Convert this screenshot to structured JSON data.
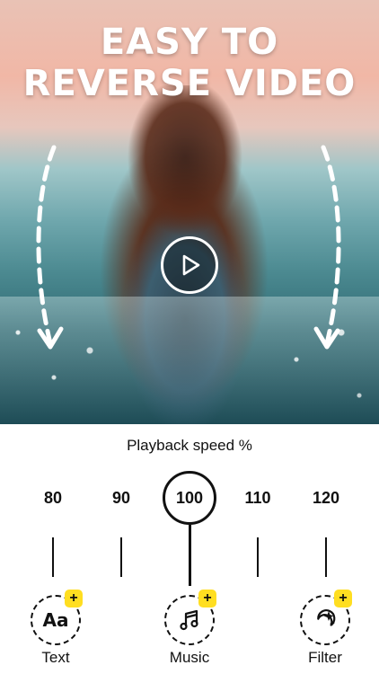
{
  "hero": {
    "headline_line1": "EASY TO",
    "headline_line2": "REVERSE VIDEO"
  },
  "icons": {
    "play": "play-icon",
    "arrow_down_left": "dashed-arrow-down-icon",
    "arrow_down_right": "dashed-arrow-down-icon",
    "text_tool": "text-aa-icon",
    "music_tool": "music-note-icon",
    "filter_tool": "sparkle-moon-icon"
  },
  "speed": {
    "title": "Playback speed %",
    "options": [
      "80",
      "90",
      "100",
      "110",
      "120"
    ],
    "selected": "100"
  },
  "tools": [
    {
      "label": "Text",
      "badge": "+",
      "glyph": "Aa"
    },
    {
      "label": "Music",
      "badge": "+"
    },
    {
      "label": "Filter",
      "badge": "+"
    }
  ],
  "colors": {
    "badge": "#ffde21",
    "ink": "#111111",
    "headline": "#ffffff"
  }
}
